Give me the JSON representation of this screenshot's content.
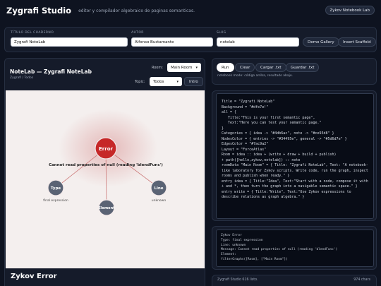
{
  "app": {
    "title": "Zygrafi Studio",
    "tagline": "editor y compilador algebraico de paginas semanticas.",
    "notebook_lab_button": "Zykov Notebook Lab"
  },
  "meta": {
    "title_label": "TÍTULO DEL CUADERNO",
    "title_value": "Zygrafi NoteLab",
    "author_label": "AUTOR",
    "author_value": "Alfonso Bustamante",
    "slug_label": "SLUG",
    "slug_value": "notelab",
    "demo_gallery": "Demo Gallery",
    "insert_scaffold": "Insert Scaffold"
  },
  "graph_panel": {
    "title": "NoteLab — Zygrafi NoteLab",
    "subtitle": "Zygrafi / Todos",
    "room_label": "Room:",
    "room_value": "Main Room",
    "topic_label": "Topic:",
    "topic_value": "Todos",
    "intro_button": "Intro",
    "error_message": "Cannot read properties of null (reading 'blendFunc')",
    "nodes": {
      "error": "Error",
      "type": "Type",
      "type_sub": "final expression",
      "line": "Line",
      "line_sub": "unknown",
      "element": "Element"
    },
    "footer_title": "Zykov Error"
  },
  "toolbar": {
    "run": "Run",
    "clear": "Clear",
    "load": "Cargar .txt",
    "save": "Guardar .txt",
    "note": "notebook mode: código arriba, resultado abajo."
  },
  "code": {
    "lines": [
      "Title = \"Zygrafi NoteLab\"",
      "Background = \"#dfe7e!\"",
      "all = {",
      "   Title:\"This is your first semantic page\",",
      "   Text:\"Here you can test your semantic page.\"",
      "}",
      "Categories = { idea -> \"#4db6ac\", note -> \"#ce93d8\" }",
      "NodesColor = { entries -> \"#34495e\", general -> \"#5d6d7e\" }",
      "EdgesColor = \"#7ac9a2\"",
      "Layout = \"ForceAtlas\"",
      "Room = idea :: idea + (write + draw + build + publish)",
      "+ path([hello,zykov,notelab]) :: note",
      "roomData \"Main Room\" = { Title: \"Zygrafi NoteLab\", Text: \"A notebook-",
      "like laboratory for Zykov scripts. Write code, run the graph, inspect",
      "rooms and publish when ready.\" }",
      "entry idea = { Title:\"Idea\", Text:\"Start with a node, compose it with",
      "+ and *, then turn the graph into a navigable semantic space.\" }",
      "entry write = { Title:\"Write\", Text:\"Use Zykov expressions to",
      "describe relations as graph algebra.\" }"
    ]
  },
  "error_log": {
    "lines": [
      "Zykov Error",
      "Type: final expression",
      "Line: unknown",
      "Message: Cannot read properties of null (reading 'blendFunc')",
      "Element:",
      "filterGraphs([Room], [\"Main Room\"])"
    ]
  },
  "status": {
    "left": "Zygrafi Studio 616 listo.",
    "right": "974 chars"
  },
  "colors": {
    "background": "#0e1320",
    "panel": "#151b2a",
    "error_node": "#c62828",
    "node": "#5a6374",
    "edge": "#cc7a7a"
  }
}
